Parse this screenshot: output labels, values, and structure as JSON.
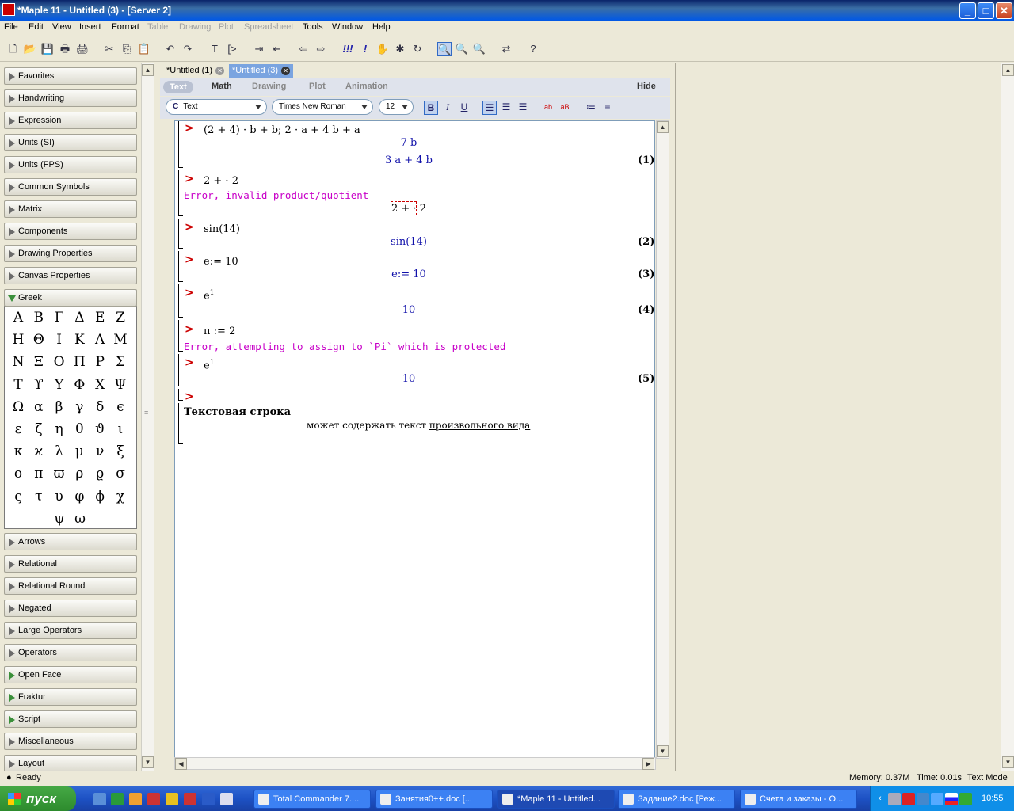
{
  "window": {
    "title": "*Maple 11 - Untitled (3) - [Server 2]",
    "min": "_",
    "max": "□",
    "close": "✕"
  },
  "menu": [
    {
      "label": "File"
    },
    {
      "label": "Edit"
    },
    {
      "label": "View"
    },
    {
      "label": "Insert"
    },
    {
      "label": "Format"
    },
    {
      "label": "Table",
      "disabled": true
    },
    {
      "label": "Drawing",
      "disabled": true
    },
    {
      "label": "Plot",
      "disabled": true
    },
    {
      "label": "Spreadsheet",
      "disabled": true
    },
    {
      "label": "Tools"
    },
    {
      "label": "Window"
    },
    {
      "label": "Help"
    }
  ],
  "toolbar": {
    "icons": [
      "new-icon",
      "open-icon",
      "save-icon",
      "print-icon",
      "print-preview-icon",
      "cut-icon",
      "copy-icon",
      "paste-icon",
      "undo-icon",
      "redo-icon",
      "text-mode-icon",
      "math-prompt-icon",
      "indent-icon",
      "outdent-icon",
      "back-icon",
      "forward-icon",
      "execute-all-icon",
      "execute-icon",
      "stop-icon",
      "debug-icon",
      "restart-icon",
      "zoom-100-icon",
      "zoom-150-icon",
      "zoom-200-icon",
      "recalc-icon",
      "help-icon"
    ],
    "glyphs": [
      "🗋",
      "📂",
      "💾",
      "🖶",
      "🖨",
      "✂",
      "⎘",
      "📋",
      "↶",
      "↷",
      "T",
      "[>",
      "⇥",
      "⇤",
      "⇦",
      "⇨",
      "!!!",
      "!",
      "✋",
      "✱",
      "↻",
      "🔍",
      "🔍",
      "🔍",
      "⇄",
      "?"
    ]
  },
  "palettes": {
    "top": [
      "Favorites",
      "Handwriting",
      "Expression",
      "Units (SI)",
      "Units (FPS)",
      "Common Symbols",
      "Matrix",
      "Components",
      "Drawing Properties",
      "Canvas Properties"
    ],
    "open": "Greek",
    "greek": [
      "Α",
      "Β",
      "Γ",
      "Δ",
      "Ε",
      "Ζ",
      "Η",
      "Θ",
      "Ι",
      "Κ",
      "Λ",
      "Μ",
      "Ν",
      "Ξ",
      "Ο",
      "Π",
      "Ρ",
      "Σ",
      "Τ",
      "ϒ",
      "Υ",
      "Φ",
      "Χ",
      "Ψ",
      "Ω",
      "α",
      "β",
      "γ",
      "δ",
      "ϵ",
      "ε",
      "ζ",
      "η",
      "θ",
      "ϑ",
      "ι",
      "κ",
      "ϰ",
      "λ",
      "μ",
      "ν",
      "ξ",
      "ο",
      "π",
      "ϖ",
      "ρ",
      "ϱ",
      "σ",
      "ς",
      "τ",
      "υ",
      "φ",
      "ϕ",
      "χ",
      "ψ",
      "ω"
    ],
    "bottom": [
      "Arrows",
      "Relational",
      "Relational Round",
      "Negated",
      "Large Operators",
      "Operators",
      "Open Face",
      "Fraktur",
      "Script",
      "Miscellaneous",
      "Layout"
    ],
    "bottom_green": [
      false,
      false,
      false,
      false,
      false,
      false,
      true,
      true,
      true,
      false,
      false
    ]
  },
  "tabs": [
    {
      "label": "*Untitled (1)",
      "active": false
    },
    {
      "label": "*Untitled (3)",
      "active": true
    }
  ],
  "context": {
    "tabs": [
      "Text",
      "Math",
      "Drawing",
      "Plot",
      "Animation"
    ],
    "active": "Text",
    "hide": "Hide"
  },
  "format": {
    "style_prefix": "C",
    "style": "Text",
    "font": "Times New Roman",
    "size": "12",
    "bold": "B",
    "italic": "I",
    "underline": "U"
  },
  "worksheet": {
    "lines": [
      {
        "kind": "input",
        "text": "(2 + 4) · b + b; 2 · a + 4 b + a"
      },
      {
        "kind": "output",
        "text": "7 b"
      },
      {
        "kind": "output",
        "text": "3 a + 4 b",
        "label": "(1)"
      },
      {
        "kind": "input",
        "text": "2 + · 2"
      },
      {
        "kind": "error",
        "text": "Error, invalid product/quotient"
      },
      {
        "kind": "echo",
        "text": "2 + · 2"
      },
      {
        "kind": "input",
        "text": "sin(14)"
      },
      {
        "kind": "output",
        "text": "sin(14)",
        "label": "(2)"
      },
      {
        "kind": "input",
        "text": "e:= 10"
      },
      {
        "kind": "output",
        "text": "e:= 10",
        "label": "(3)"
      },
      {
        "kind": "input",
        "text": "e",
        "sup": "1"
      },
      {
        "kind": "output",
        "text": "10",
        "label": "(4)"
      },
      {
        "kind": "input",
        "text": "π := 2"
      },
      {
        "kind": "error",
        "text": "Error, attempting to assign to `Pi` which is protected"
      },
      {
        "kind": "input",
        "text": "e",
        "sup": "1"
      },
      {
        "kind": "output",
        "text": "10",
        "label": "(5)"
      },
      {
        "kind": "prompt",
        "text": ""
      },
      {
        "kind": "heading",
        "text": "Текстовая строка"
      },
      {
        "kind": "text",
        "text": "может содержать текст ",
        "underlined": "произвольного вида"
      }
    ]
  },
  "status": {
    "ready": "Ready",
    "memory": "Memory: 0.37M",
    "time": "Time: 0.01s",
    "mode": "Text Mode"
  },
  "taskbar": {
    "start": "пуск",
    "tasks": [
      {
        "label": "Total Commander 7....",
        "active": false
      },
      {
        "label": "Занятия0++.doc [...",
        "active": false
      },
      {
        "label": "*Maple 11 - Untitled...",
        "active": true
      },
      {
        "label": "Задание2.doc [Реж...",
        "active": false
      },
      {
        "label": "Счета и заказы - О...",
        "active": false
      }
    ],
    "clock": "10:55"
  }
}
